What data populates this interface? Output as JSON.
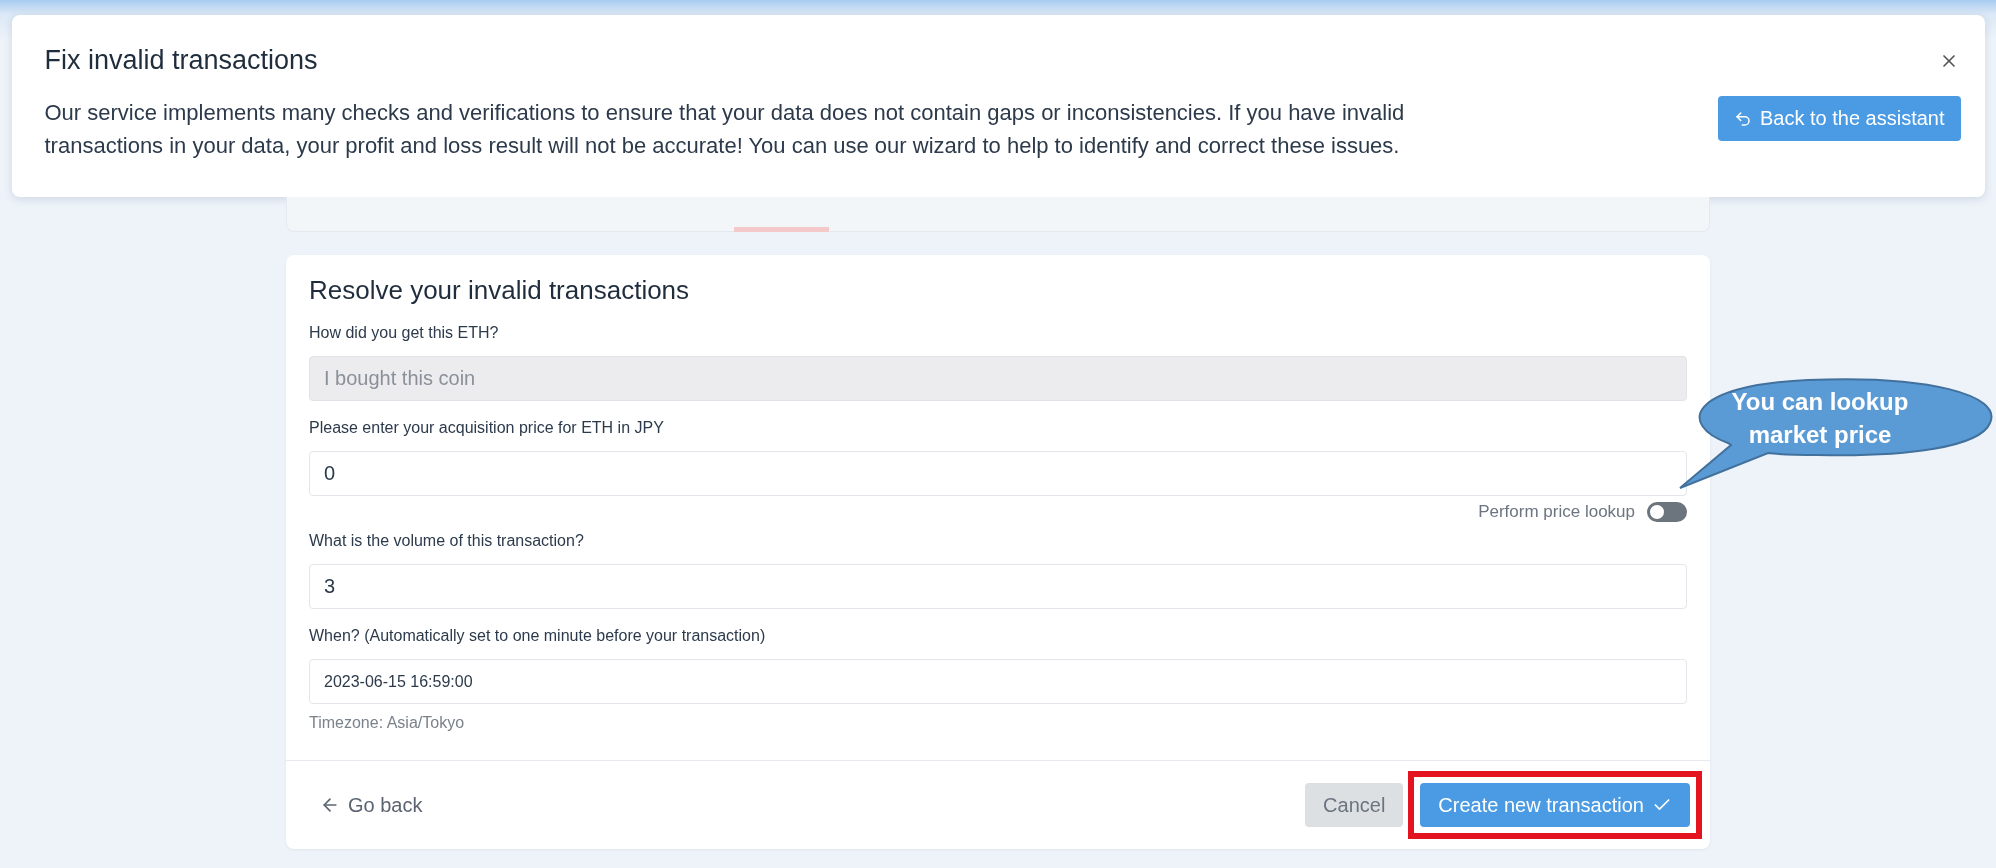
{
  "header": {
    "title": "Fix invalid transactions",
    "description": "Our service implements many checks and verifications to ensure that your data does not contain gaps or inconsistencies. If you have invalid transactions in your data, your profit and loss result will not be accurate! You can use our wizard to help to identify and correct these issues.",
    "back_button": "Back to the assistant"
  },
  "form": {
    "title": "Resolve your invalid transactions",
    "fields": [
      {
        "kind": "select",
        "label": "How did you get this ETH?",
        "value": "I bought this coin",
        "disabled": true
      },
      {
        "kind": "input",
        "label": "Please enter your acquisition price for ETH in JPY",
        "value": "0",
        "disabled": false,
        "toggle": {
          "label": "Perform price lookup",
          "on": false
        }
      },
      {
        "kind": "input",
        "label": "What is the volume of this transaction?",
        "value": "3",
        "disabled": false
      },
      {
        "kind": "datetime",
        "label": "When? (Automatically set to one minute before your transaction)",
        "value": "2023-06-15 16:59:00",
        "disabled": false,
        "hint": "Timezone: Asia/Tokyo"
      }
    ],
    "go_back": "Go back",
    "cancel": "Cancel",
    "submit": {
      "label": "Create new transaction",
      "highlighted": true
    }
  },
  "callout": {
    "text": "You can lookup market price"
  }
}
